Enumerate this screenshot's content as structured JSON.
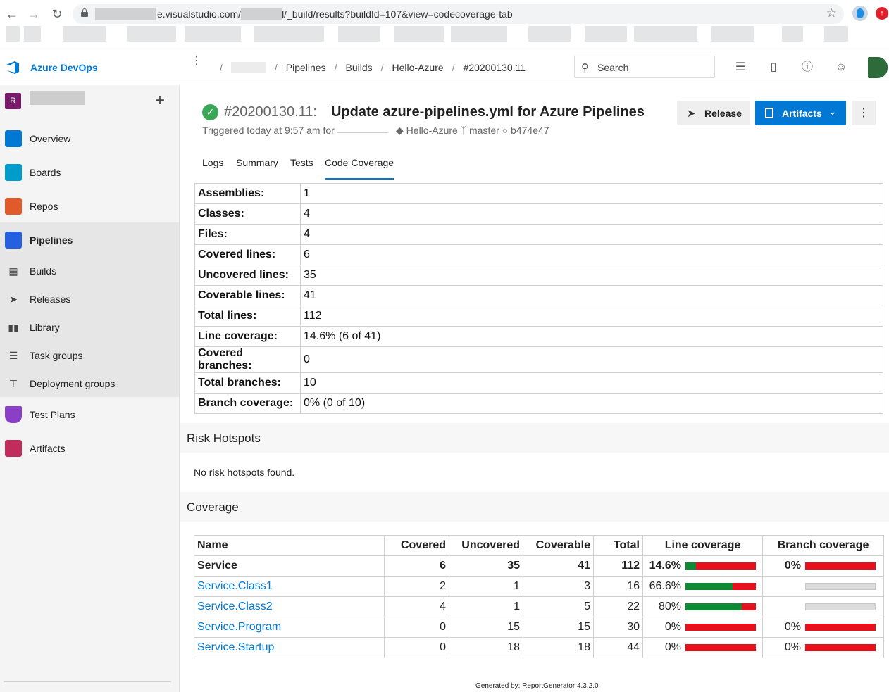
{
  "browser": {
    "url_visible": "e.visualstudio.com/",
    "url_mid": "l/_build/results?buildId=107&view=codecoverage-tab"
  },
  "header": {
    "brand": "Azure DevOps",
    "crumbs": [
      "Pipelines",
      "Builds",
      "Hello-Azure",
      "#20200130.11"
    ],
    "search_placeholder": "Search"
  },
  "sidebar": {
    "org_initial": "R",
    "items": [
      {
        "label": "Overview",
        "color": "#0078d4"
      },
      {
        "label": "Boards",
        "color": "#009ccc"
      },
      {
        "label": "Repos",
        "color": "#e05a2b"
      },
      {
        "label": "Pipelines",
        "color": "#2560e0"
      }
    ],
    "pipeline_sub": [
      "Builds",
      "Releases",
      "Library",
      "Task groups",
      "Deployment groups"
    ],
    "bottom_items": [
      {
        "label": "Test Plans",
        "color": "#8a3fc7"
      },
      {
        "label": "Artifacts",
        "color": "#c02c5c"
      }
    ]
  },
  "build": {
    "number": "#20200130.11:",
    "title": "Update azure-pipelines.yml for Azure Pipelines",
    "triggered": "Triggered today at 9:57 am for",
    "repo": "Hello-Azure",
    "branch": "master",
    "commit": "b474e47",
    "release_label": "Release",
    "artifacts_label": "Artifacts",
    "tabs": [
      "Logs",
      "Summary",
      "Tests",
      "Code Coverage"
    ]
  },
  "summary": [
    {
      "k": "Assemblies:",
      "v": "1"
    },
    {
      "k": "Classes:",
      "v": "4"
    },
    {
      "k": "Files:",
      "v": "4"
    },
    {
      "k": "Covered lines:",
      "v": "6"
    },
    {
      "k": "Uncovered lines:",
      "v": "35"
    },
    {
      "k": "Coverable lines:",
      "v": "41"
    },
    {
      "k": "Total lines:",
      "v": "112"
    },
    {
      "k": "Line coverage:",
      "v": "14.6% (6 of 41)"
    },
    {
      "k": "Covered branches:",
      "v": "0"
    },
    {
      "k": "Total branches:",
      "v": "10"
    },
    {
      "k": "Branch coverage:",
      "v": "0% (0 of 10)"
    }
  ],
  "risk": {
    "heading": "Risk Hotspots",
    "message": "No risk hotspots found."
  },
  "coverage": {
    "heading": "Coverage",
    "columns": [
      "Name",
      "Covered",
      "Uncovered",
      "Coverable",
      "Total",
      "Line coverage",
      "Branch coverage"
    ],
    "rows": [
      {
        "name": "Service",
        "covered": "6",
        "uncovered": "35",
        "coverable": "41",
        "total": "112",
        "line_pct": "14.6%",
        "line_frac": 0.146,
        "branch_pct": "0%",
        "branch_frac": 0,
        "has_branch": true,
        "bold": true
      },
      {
        "name": "Service.Class1",
        "covered": "2",
        "uncovered": "1",
        "coverable": "3",
        "total": "16",
        "line_pct": "66.6%",
        "line_frac": 0.666,
        "branch_pct": "",
        "branch_frac": null,
        "has_branch": false,
        "bold": false
      },
      {
        "name": "Service.Class2",
        "covered": "4",
        "uncovered": "1",
        "coverable": "5",
        "total": "22",
        "line_pct": "80%",
        "line_frac": 0.8,
        "branch_pct": "",
        "branch_frac": null,
        "has_branch": false,
        "bold": false
      },
      {
        "name": "Service.Program",
        "covered": "0",
        "uncovered": "15",
        "coverable": "15",
        "total": "30",
        "line_pct": "0%",
        "line_frac": 0,
        "branch_pct": "0%",
        "branch_frac": 0,
        "has_branch": true,
        "bold": false
      },
      {
        "name": "Service.Startup",
        "covered": "0",
        "uncovered": "18",
        "coverable": "18",
        "total": "44",
        "line_pct": "0%",
        "line_frac": 0,
        "branch_pct": "0%",
        "branch_frac": 0,
        "has_branch": true,
        "bold": false
      }
    ]
  },
  "footer": "Generated by: ReportGenerator 4.3.2.0"
}
